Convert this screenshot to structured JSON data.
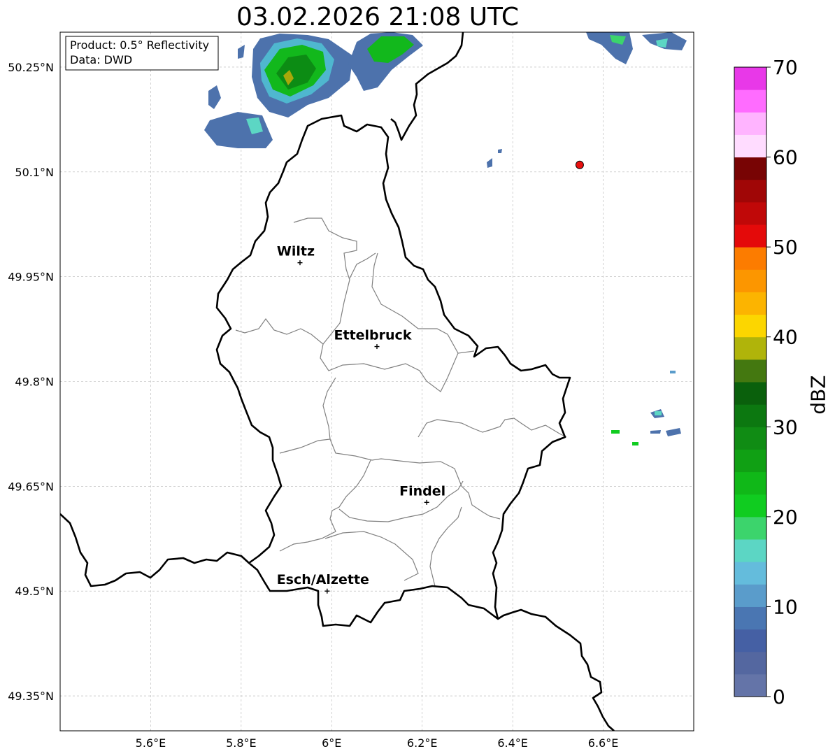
{
  "title": "03.02.2026 21:08 UTC",
  "info_box": {
    "product": "Product: 0.5° Reflectivity",
    "data": "Data: DWD"
  },
  "axes": {
    "lon_ticks": [
      "5.6°E",
      "5.8°E",
      "6°E",
      "6.2°E",
      "6.4°E",
      "6.6°E"
    ],
    "lat_ticks": [
      "50.25°N",
      "50.1°N",
      "49.95°N",
      "49.8°N",
      "49.65°N",
      "49.5°N",
      "49.35°N"
    ],
    "lon_range": [
      5.4,
      6.8
    ],
    "lat_range": [
      49.3,
      50.3
    ]
  },
  "cities": [
    {
      "name": "Wiltz",
      "lon": 5.93,
      "lat": 49.97
    },
    {
      "name": "Ettelbruck",
      "lon": 6.1,
      "lat": 49.85
    },
    {
      "name": "Findel",
      "lon": 6.21,
      "lat": 49.627
    },
    {
      "name": "Esch/Alzette",
      "lon": 5.99,
      "lat": 49.5
    }
  ],
  "radar_site": {
    "lon": 6.548,
    "lat": 50.11,
    "color": "#e8100f"
  },
  "colorbar": {
    "label": "dBZ",
    "ticks": [
      "0",
      "10",
      "20",
      "30",
      "40",
      "50",
      "60",
      "70"
    ],
    "colors": [
      "#6474a8",
      "#5467a0",
      "#4560a4",
      "#4a76b2",
      "#5a9ccb",
      "#64bcdc",
      "#5cd6c4",
      "#3cd46c",
      "#10cc20",
      "#10b818",
      "#10a014",
      "#108c14",
      "#0c7810",
      "#0a600c",
      "#447810",
      "#b0b40a",
      "#fcd600",
      "#fcb400",
      "#fc9600",
      "#fc7c00",
      "#e40a0a",
      "#c00808",
      "#a00606",
      "#780404",
      "#ffdcff",
      "#ffb4ff",
      "#ff6cff",
      "#e838e8"
    ]
  }
}
